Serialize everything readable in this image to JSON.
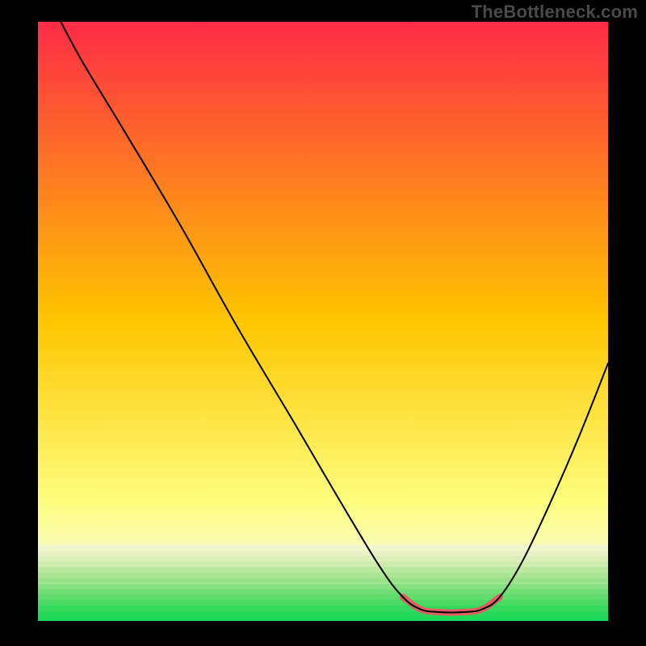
{
  "watermark": "TheBottleneck.com",
  "chart_data": {
    "type": "line",
    "title": "",
    "xlabel": "",
    "ylabel": "",
    "xlim": [
      0,
      100
    ],
    "ylim": [
      0,
      100
    ],
    "grid": false,
    "legend": false,
    "background_gradient": {
      "stops": [
        {
          "offset": 0.0,
          "color": "#fd2b46"
        },
        {
          "offset": 0.5,
          "color": "#fec600"
        },
        {
          "offset": 0.8,
          "color": "#fdfd7d"
        },
        {
          "offset": 0.92,
          "color": "#f5fbd4"
        },
        {
          "offset": 1.0,
          "color": "#1bd858"
        }
      ]
    },
    "bottom_stripes": [
      {
        "color": "#f0f6cd",
        "y": 0.873
      },
      {
        "color": "#e8f2c6",
        "y": 0.883
      },
      {
        "color": "#dcefb9",
        "y": 0.892
      },
      {
        "color": "#cdebad",
        "y": 0.901
      },
      {
        "color": "#bde8a1",
        "y": 0.91
      },
      {
        "color": "#ace595",
        "y": 0.919
      },
      {
        "color": "#9ae28a",
        "y": 0.928
      },
      {
        "color": "#86e07f",
        "y": 0.938
      },
      {
        "color": "#72dd75",
        "y": 0.947
      },
      {
        "color": "#5ddb6b",
        "y": 0.956
      },
      {
        "color": "#48da62",
        "y": 0.965
      },
      {
        "color": "#36d85c",
        "y": 0.974
      },
      {
        "color": "#27d858",
        "y": 0.984
      },
      {
        "color": "#1bd857",
        "y": 0.993
      }
    ],
    "series": [
      {
        "name": "curve",
        "color": "#000000",
        "points": [
          {
            "x": 4.0,
            "y": 100.0
          },
          {
            "x": 8.0,
            "y": 93.0
          },
          {
            "x": 15.0,
            "y": 82.0
          },
          {
            "x": 25.0,
            "y": 66.0
          },
          {
            "x": 35.0,
            "y": 49.0
          },
          {
            "x": 45.0,
            "y": 33.0
          },
          {
            "x": 53.0,
            "y": 20.0
          },
          {
            "x": 60.0,
            "y": 9.0
          },
          {
            "x": 64.0,
            "y": 4.0
          },
          {
            "x": 67.0,
            "y": 2.0
          },
          {
            "x": 70.0,
            "y": 1.5
          },
          {
            "x": 75.0,
            "y": 1.5
          },
          {
            "x": 78.0,
            "y": 2.0
          },
          {
            "x": 81.0,
            "y": 4.0
          },
          {
            "x": 85.0,
            "y": 10.0
          },
          {
            "x": 90.0,
            "y": 20.0
          },
          {
            "x": 95.0,
            "y": 31.0
          },
          {
            "x": 100.0,
            "y": 43.0
          }
        ]
      }
    ],
    "highlight_segments": [
      {
        "name": "valley-highlight",
        "color": "#df5f63",
        "width": 8,
        "points": [
          {
            "x": 64.0,
            "y": 4.0
          },
          {
            "x": 67.0,
            "y": 2.0
          },
          {
            "x": 70.0,
            "y": 1.5
          },
          {
            "x": 75.0,
            "y": 1.5
          },
          {
            "x": 78.0,
            "y": 2.0
          },
          {
            "x": 81.0,
            "y": 4.0
          }
        ]
      }
    ]
  }
}
